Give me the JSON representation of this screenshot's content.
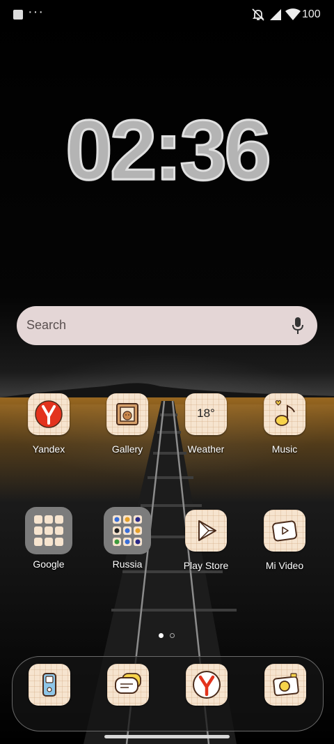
{
  "status_bar": {
    "battery": "100",
    "overflow_dots": "···"
  },
  "clock": {
    "time": "02:36"
  },
  "search": {
    "placeholder": "Search"
  },
  "apps": [
    {
      "label": "Yandex",
      "icon": "yandex-icon"
    },
    {
      "label": "Gallery",
      "icon": "gallery-icon"
    },
    {
      "label": "Weather",
      "icon": "weather-icon",
      "badge": "18°"
    },
    {
      "label": "Music",
      "icon": "music-icon"
    },
    {
      "label": "Google",
      "icon": "google-folder-icon"
    },
    {
      "label": "Russia",
      "icon": "russia-folder-icon"
    },
    {
      "label": "Play Store",
      "icon": "play-store-icon"
    },
    {
      "label": "Mi Video",
      "icon": "mi-video-icon"
    }
  ],
  "page_indicator": {
    "count": 2,
    "active": 0
  },
  "dock": [
    {
      "icon": "phone-icon"
    },
    {
      "icon": "messages-icon"
    },
    {
      "icon": "yandex-browser-icon"
    },
    {
      "icon": "camera-icon"
    }
  ]
}
